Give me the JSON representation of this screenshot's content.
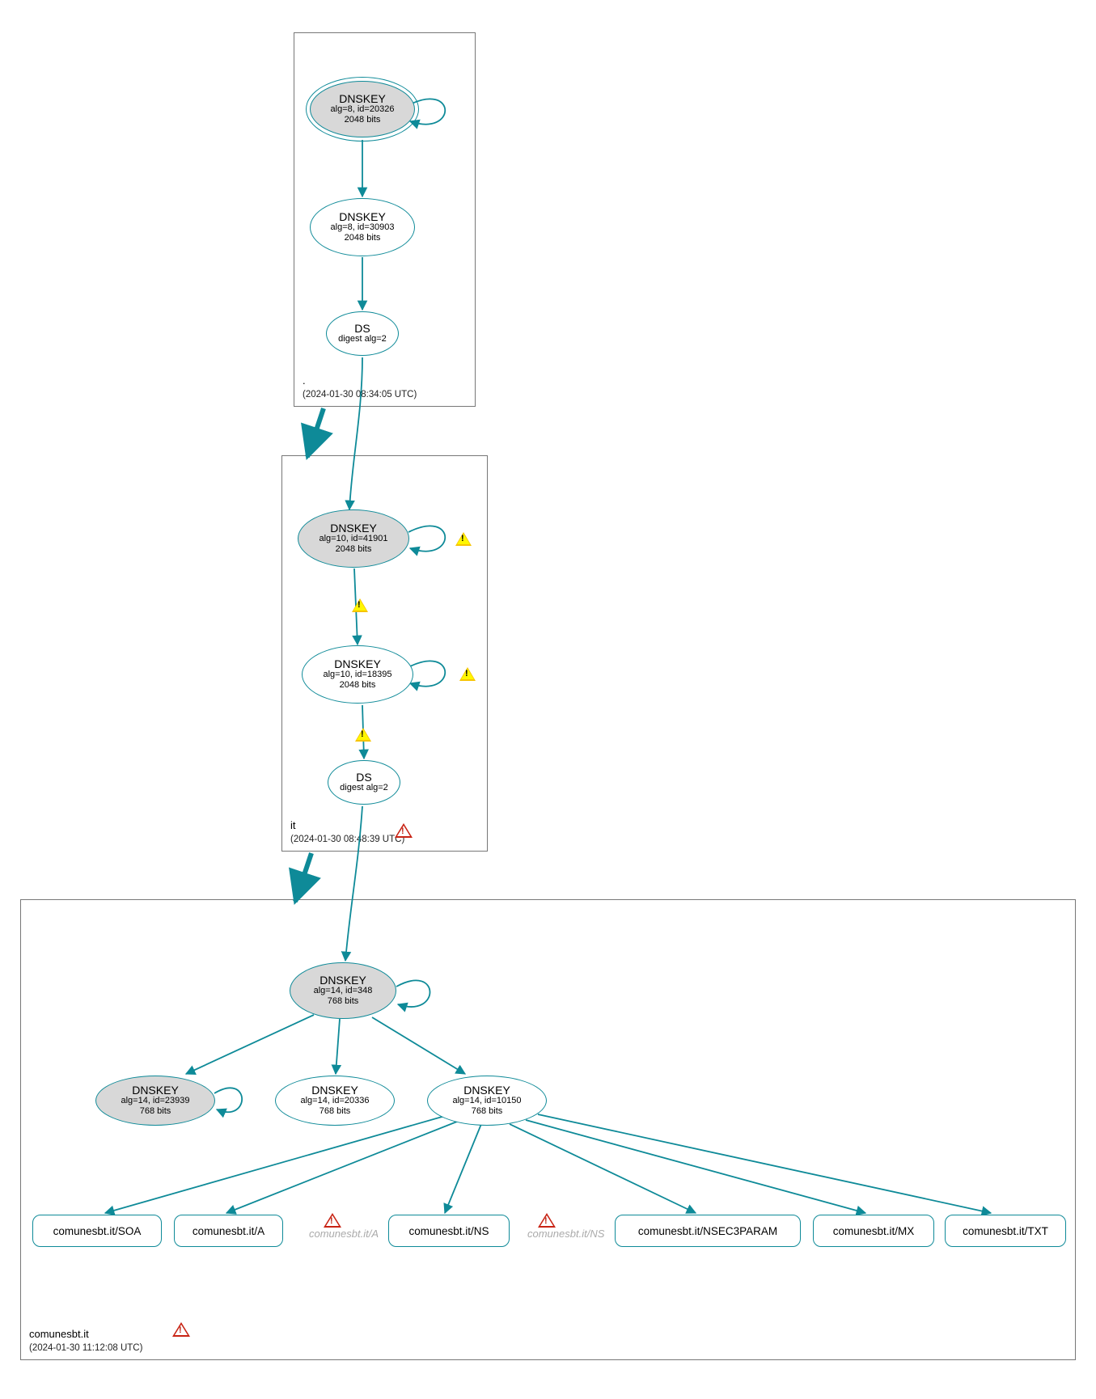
{
  "zones": {
    "root": {
      "name": ".",
      "timestamp": "(2024-01-30 08:34:05 UTC)"
    },
    "it": {
      "name": "it",
      "timestamp": "(2024-01-30 08:48:39 UTC)"
    },
    "leaf": {
      "name": "comunesbt.it",
      "timestamp": "(2024-01-30 11:12:08 UTC)"
    }
  },
  "nodes": {
    "root_ksk": {
      "title": "DNSKEY",
      "line1": "alg=8, id=20326",
      "line2": "2048 bits"
    },
    "root_zsk": {
      "title": "DNSKEY",
      "line1": "alg=8, id=30903",
      "line2": "2048 bits"
    },
    "root_ds": {
      "title": "DS",
      "line1": "digest alg=2",
      "line2": ""
    },
    "it_ksk": {
      "title": "DNSKEY",
      "line1": "alg=10, id=41901",
      "line2": "2048 bits"
    },
    "it_zsk": {
      "title": "DNSKEY",
      "line1": "alg=10, id=18395",
      "line2": "2048 bits"
    },
    "it_ds": {
      "title": "DS",
      "line1": "digest alg=2",
      "line2": ""
    },
    "leaf_ksk": {
      "title": "DNSKEY",
      "line1": "alg=14, id=348",
      "line2": "768 bits"
    },
    "leaf_k2": {
      "title": "DNSKEY",
      "line1": "alg=14, id=23939",
      "line2": "768 bits"
    },
    "leaf_k3": {
      "title": "DNSKEY",
      "line1": "alg=14, id=20336",
      "line2": "768 bits"
    },
    "leaf_k4": {
      "title": "DNSKEY",
      "line1": "alg=14, id=10150",
      "line2": "768 bits"
    }
  },
  "rr": {
    "soa": "comunesbt.it/SOA",
    "a": "comunesbt.it/A",
    "ns": "comunesbt.it/NS",
    "nsec": "comunesbt.it/NSEC3PARAM",
    "mx": "comunesbt.it/MX",
    "txt": "comunesbt.it/TXT"
  },
  "phantom": {
    "a": "comunesbt.it/A",
    "ns": "comunesbt.it/NS"
  }
}
